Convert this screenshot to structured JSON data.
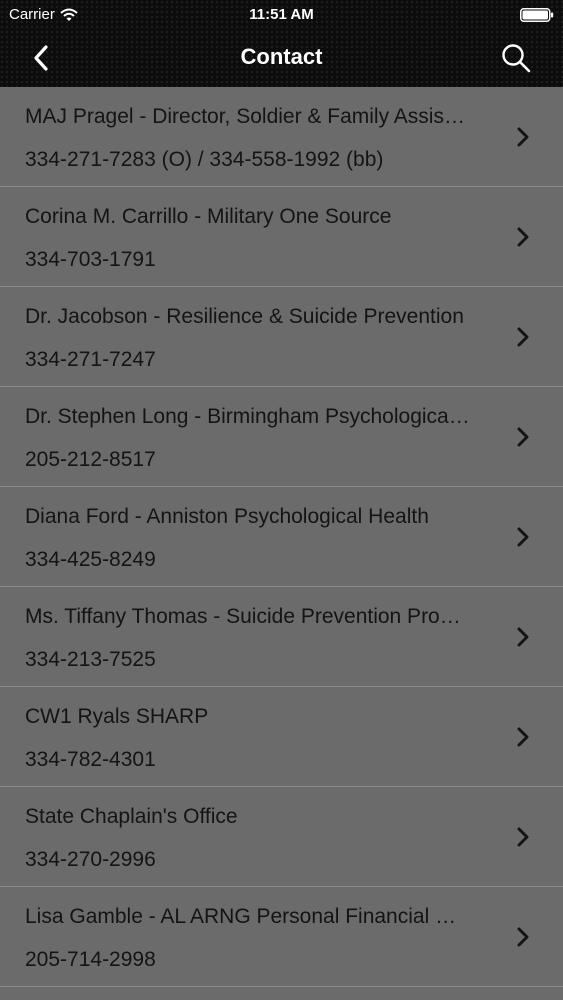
{
  "status_bar": {
    "carrier": "Carrier",
    "time": "11:51 AM",
    "wifi_icon": "wifi-icon",
    "battery_icon": "battery-full-icon"
  },
  "nav_bar": {
    "title": "Contact",
    "back_icon": "chevron-left-icon",
    "search_icon": "search-icon"
  },
  "contacts": [
    {
      "name": "MAJ Pragel - Director, Soldier & Family Assistance Center",
      "phone": "334-271-7283 (O) / 334-558-1992 (bb)"
    },
    {
      "name": "Corina M. Carrillo - Military One Source",
      "phone": "334-703-1791"
    },
    {
      "name": "Dr. Jacobson - Resilience & Suicide Prevention",
      "phone": "334-271-7247"
    },
    {
      "name": "Dr. Stephen Long - Birmingham Psychological Health",
      "phone": "205-212-8517"
    },
    {
      "name": "Diana Ford - Anniston Psychological Health",
      "phone": "334-425-8249"
    },
    {
      "name": "Ms. Tiffany Thomas - Suicide Prevention Program",
      "phone": "334-213-7525"
    },
    {
      "name": "CW1 Ryals SHARP",
      "phone": "334-782-4301"
    },
    {
      "name": "State Chaplain's Office",
      "phone": "334-270-2996"
    },
    {
      "name": "Lisa Gamble - AL ARNG Personal Financial Counselor",
      "phone": "205-714-2998"
    }
  ],
  "colors": {
    "background": "#6b6b6b",
    "bar": "#0c0c0c",
    "text": "#141414",
    "divider": "#8a8a8a"
  }
}
